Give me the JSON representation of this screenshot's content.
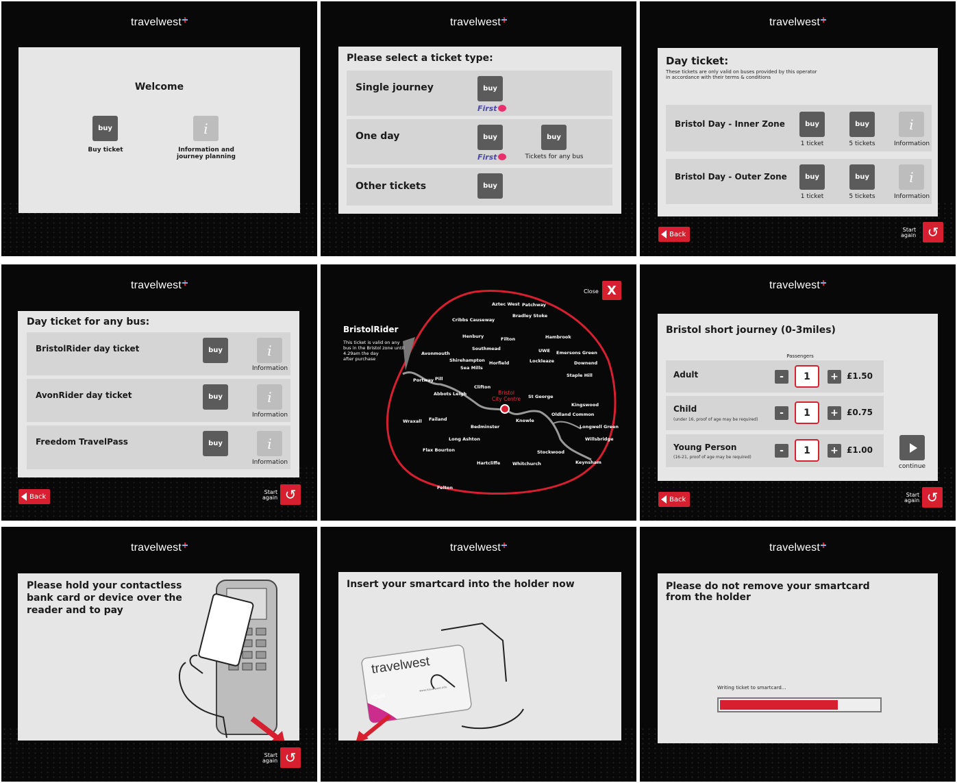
{
  "brand": {
    "logo": "travelwest"
  },
  "common": {
    "back": "Back",
    "start_again_line1": "Start",
    "start_again_line2": "again",
    "buy": "buy",
    "info_glyph": "i",
    "information": "Information",
    "first_logo": "First",
    "continue": "continue"
  },
  "welcome": {
    "title": "Welcome",
    "buy_ticket": "Buy ticket",
    "info_line1": "Information and",
    "info_line2": "journey planning"
  },
  "ticket_type": {
    "title": "Please select a ticket type:",
    "rows": [
      {
        "label": "Single journey"
      },
      {
        "label": "One day",
        "any_bus": "Tickets for any bus"
      },
      {
        "label": "Other tickets"
      }
    ]
  },
  "day_ticket": {
    "title": "Day ticket:",
    "note_line1": "These tickets are only valid on buses provided by this operator",
    "note_line2": "in accordance with their terms & conditions",
    "rows": [
      {
        "label": "Bristol Day - Inner Zone",
        "opt1": "1 ticket",
        "opt2": "5 tickets"
      },
      {
        "label": "Bristol Day - Outer Zone",
        "opt1": "1 ticket",
        "opt2": "5 tickets"
      }
    ]
  },
  "any_bus": {
    "title": "Day ticket for any bus:",
    "rows": [
      {
        "label": "BristolRider day ticket"
      },
      {
        "label": "AvonRider day ticket"
      },
      {
        "label": "Freedom TravelPass"
      }
    ]
  },
  "map": {
    "title": "BristolRider",
    "desc_line1": "This ticket is valid on any",
    "desc_line2": "bus in the Bristol zone until",
    "desc_line3": "4.29am the day",
    "desc_line4": "after purchase",
    "close": "Close",
    "close_glyph": "X",
    "centre_line1": "Bristol",
    "centre_line2": "City Centre",
    "places": [
      "Aztec West",
      "Patchway",
      "Bradley Stoke",
      "Cribbs Causeway",
      "Henbury",
      "Filton",
      "Hambrook",
      "Southmead",
      "UWE",
      "Emersons Green",
      "Avonmouth",
      "Shirehampton",
      "Horfield",
      "Lockleaze",
      "Downend",
      "Sea Mills",
      "Staple Hill",
      "Portway",
      "Pill",
      "Clifton",
      "Abbots Leigh",
      "St George",
      "Kingswood",
      "Wraxall",
      "Failand",
      "Knowle",
      "Oldland Common",
      "Bedminster",
      "Longwell Green",
      "Long Ashton",
      "Willsbridge",
      "Flax Bourton",
      "Stockwood",
      "Hartcliffe",
      "Whitchurch",
      "Keynsham",
      "Felton"
    ]
  },
  "short_journey": {
    "title": "Bristol short journey (0-3miles)",
    "passengers": "Passengers",
    "minus": "-",
    "plus": "+",
    "rows": [
      {
        "label": "Adult",
        "sub": "",
        "qty": "1",
        "price": "£1.50"
      },
      {
        "label": "Child",
        "sub": "(under 16, proof of age may be required)",
        "qty": "1",
        "price": "£0.75"
      },
      {
        "label": "Young Person",
        "sub": "(16-21, proof of age may be required)",
        "qty": "1",
        "price": "£1.00"
      }
    ]
  },
  "contactless": {
    "line1": "Please hold your contactless",
    "line2": "bank card or device over the",
    "line3": "reader and to pay"
  },
  "insert_card": {
    "title": "Insert your smartcard into the holder now",
    "card_brand": "travelwest",
    "card_squid": "sQuid",
    "card_url": "www.travelwest.info"
  },
  "writing": {
    "line1": "Please do not remove your smartcard",
    "line2": "from the holder",
    "status": "Writing ticket to smartcard...",
    "progress": 0.74
  },
  "colors": {
    "accent": "#d62030",
    "button": "#5b5b5b",
    "panel": "#e6e6e6",
    "row": "#d5d5d5"
  }
}
